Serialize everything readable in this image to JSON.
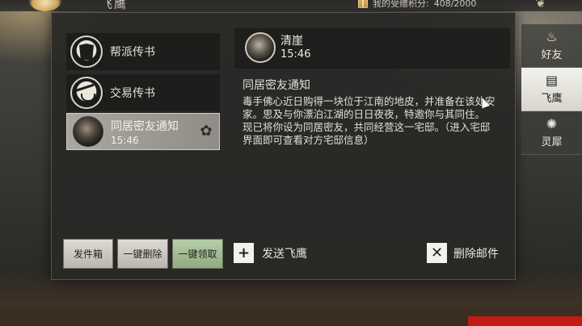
{
  "header": {
    "title": "飞鹰",
    "score_label": "我的受赠积分:",
    "score_value": "408/2000"
  },
  "mail_list": [
    {
      "title": "帮派传书",
      "time": "",
      "icon": "sect-gate-icon"
    },
    {
      "title": "交易传书",
      "time": "",
      "icon": "balance-scale-icon"
    },
    {
      "title": "同居密友通知",
      "time": "15:46",
      "icon": "avatar",
      "selected": true
    }
  ],
  "buttons": {
    "outbox": "发件箱",
    "delete_all": "一键删除",
    "claim_all": "一键领取"
  },
  "mail_detail": {
    "sender": "清崖",
    "time": "15:46",
    "heading": "同居密友通知",
    "body": [
      "毒手佛心近日购得一块位于江南的地皮，并准备在该处安家。思及与你漂泊江湖的日日夜夜，特邀你与其同住。",
      "现已将你设为同居密友，共同经营这一宅邸。（进入宅邸界面即可查看对方宅邸信息）"
    ]
  },
  "actions": {
    "send": "发送飞鹰",
    "delete": "删除邮件"
  },
  "side_tabs": [
    {
      "label": "好友",
      "icon": "teapot-icon"
    },
    {
      "label": "飞鹰",
      "icon": "scroll-icon",
      "active": true
    },
    {
      "label": "灵犀",
      "icon": "lantern-icon"
    }
  ]
}
